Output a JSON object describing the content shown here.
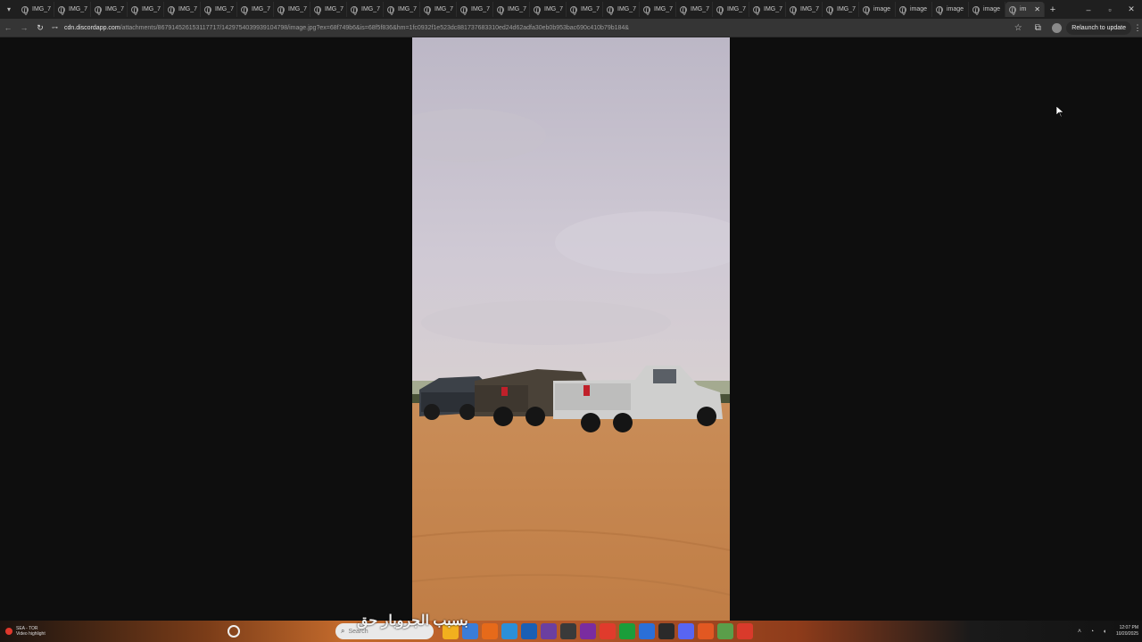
{
  "browser": {
    "tabs": [
      {
        "title": "IMG_7",
        "active": false
      },
      {
        "title": "IMG_7",
        "active": false
      },
      {
        "title": "IMG_7",
        "active": false
      },
      {
        "title": "IMG_7",
        "active": false
      },
      {
        "title": "IMG_7",
        "active": false
      },
      {
        "title": "IMG_7",
        "active": false
      },
      {
        "title": "IMG_7",
        "active": false
      },
      {
        "title": "IMG_7",
        "active": false
      },
      {
        "title": "IMG_7",
        "active": false
      },
      {
        "title": "IMG_7",
        "active": false
      },
      {
        "title": "IMG_7",
        "active": false
      },
      {
        "title": "IMG_7",
        "active": false
      },
      {
        "title": "IMG_7",
        "active": false
      },
      {
        "title": "IMG_7",
        "active": false
      },
      {
        "title": "IMG_7",
        "active": false
      },
      {
        "title": "IMG_7",
        "active": false
      },
      {
        "title": "IMG_7",
        "active": false
      },
      {
        "title": "IMG_7",
        "active": false
      },
      {
        "title": "IMG_7",
        "active": false
      },
      {
        "title": "IMG_7",
        "active": false
      },
      {
        "title": "IMG_7",
        "active": false
      },
      {
        "title": "IMG_7",
        "active": false
      },
      {
        "title": "IMG_7",
        "active": false
      },
      {
        "title": "image",
        "active": false
      },
      {
        "title": "image",
        "active": false
      },
      {
        "title": "image",
        "active": false
      },
      {
        "title": "image",
        "active": false
      },
      {
        "title": "im",
        "active": true
      }
    ],
    "new_tab": "+",
    "window_controls": {
      "minimize": "–",
      "restore": "▫",
      "close": "✕"
    },
    "url_host": "cdn.discordapp.com",
    "url_path": "/attachments/867914526153117717/1429754039939104798/image.jpg?ex=68f749b6&is=68f5f836&hm=1fc0932f1e523dc881737683310ed24d62adfa30eb0b953bac690c410b79b184&",
    "relaunch_label": "Relaunch to update",
    "icons": {
      "back": "back-arrow-icon",
      "forward": "forward-arrow-icon",
      "reload": "reload-icon",
      "bookmark": "star-icon",
      "extensions": "puzzle-icon",
      "menu": "kebab-icon"
    }
  },
  "taskbar": {
    "weather_line1": "SEA - TOR",
    "weather_line2": "Video highlight",
    "search_placeholder": "Search",
    "subtitle_overlay": "بسبب الجروبار حق",
    "clock_time": "12:07 PM",
    "clock_date": "10/20/2025",
    "app_colors": [
      "#f2b01e",
      "#3b7dd8",
      "#e66a1a",
      "#2b8fd8",
      "#1a5fb4",
      "#6b3fa0",
      "#3a3a3a",
      "#7a2ca0",
      "#e03b2c",
      "#1a9e3a",
      "#2b6fd8",
      "#2a2a2a",
      "#5865f2",
      "#e25822",
      "#5a9e4a",
      "#d93a2b"
    ]
  },
  "photo": {
    "sky_top": "#bab6c4",
    "sky_bottom": "#d4cfd8",
    "sand": "#c8874e"
  }
}
